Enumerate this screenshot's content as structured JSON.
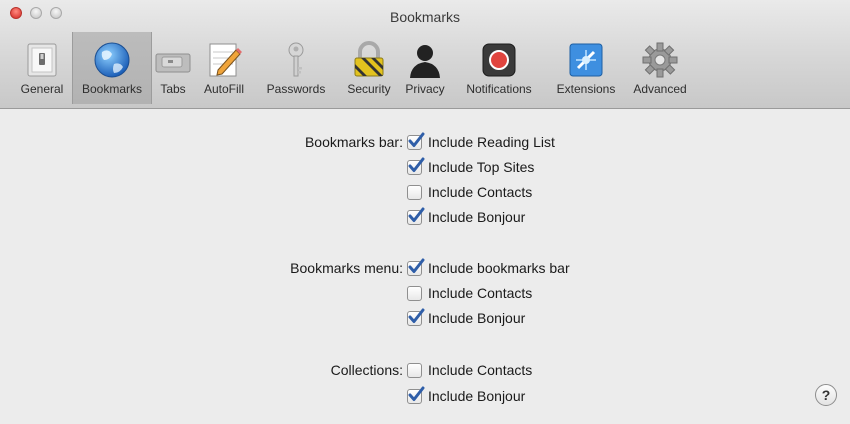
{
  "window": {
    "title": "Bookmarks"
  },
  "toolbar": {
    "items": [
      {
        "label": "General",
        "icon": "general-switch-icon",
        "selected": false
      },
      {
        "label": "Bookmarks",
        "icon": "globe-icon",
        "selected": true
      },
      {
        "label": "Tabs",
        "icon": "tabs-icon",
        "selected": false
      },
      {
        "label": "AutoFill",
        "icon": "autofill-pencil-icon",
        "selected": false
      },
      {
        "label": "Passwords",
        "icon": "key-icon",
        "selected": false
      },
      {
        "label": "Security",
        "icon": "lock-icon",
        "selected": false
      },
      {
        "label": "Privacy",
        "icon": "person-silhouette-icon",
        "selected": false
      },
      {
        "label": "Notifications",
        "icon": "notification-icon",
        "selected": false
      },
      {
        "label": "Extensions",
        "icon": "extensions-puzzle-icon",
        "selected": false
      },
      {
        "label": "Advanced",
        "icon": "gear-icon",
        "selected": false
      }
    ]
  },
  "sections": [
    {
      "label": "Bookmarks bar:",
      "options": [
        {
          "text": "Include Reading List",
          "checked": true
        },
        {
          "text": "Include Top Sites",
          "checked": true
        },
        {
          "text": "Include Contacts",
          "checked": false
        },
        {
          "text": "Include Bonjour",
          "checked": true
        }
      ]
    },
    {
      "label": "Bookmarks menu:",
      "options": [
        {
          "text": "Include bookmarks bar",
          "checked": true
        },
        {
          "text": "Include Contacts",
          "checked": false
        },
        {
          "text": "Include Bonjour",
          "checked": true
        }
      ]
    },
    {
      "label": "Collections:",
      "options": [
        {
          "text": "Include Contacts",
          "checked": false
        },
        {
          "text": "Include Bonjour",
          "checked": true
        }
      ]
    }
  ],
  "help": {
    "label": "?"
  },
  "colors": {
    "check": "#2f5ea8",
    "close": "#e0443e"
  }
}
